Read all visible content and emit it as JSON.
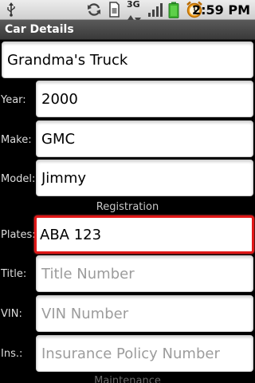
{
  "status_bar": {
    "time": "2:59 PM",
    "network_type": "3G",
    "icons": [
      "usb-icon",
      "sync-icon",
      "sim-icon",
      "3g-icon",
      "signal-icon",
      "battery-icon",
      "alarm-icon"
    ]
  },
  "title": "Car Details",
  "form": {
    "name": {
      "value": "Grandma's Truck",
      "placeholder": ""
    },
    "year": {
      "label": "Year:",
      "value": "2000"
    },
    "make": {
      "label": "Make:",
      "value": "GMC"
    },
    "model": {
      "label": "Model:",
      "value": "Jimmy"
    },
    "registration_header": "Registration",
    "plates": {
      "label": "Plates:",
      "value": "ABA 123"
    },
    "title_number": {
      "label": "Title:",
      "value": "",
      "placeholder": "Title Number"
    },
    "vin": {
      "label": "VIN:",
      "value": "",
      "placeholder": "VIN Number"
    },
    "insurance": {
      "label": "Ins.:",
      "value": "",
      "placeholder": "Insurance Policy Number"
    },
    "maintenance_header": "Maintenance"
  },
  "colors": {
    "focus_border": "#e01818",
    "background": "#000000",
    "field_background": "#ffffff",
    "placeholder": "#9c9c9c"
  }
}
